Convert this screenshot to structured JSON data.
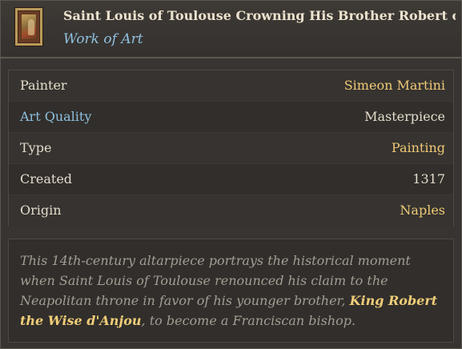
{
  "header": {
    "title": "Saint Louis of Toulouse Crowning His Brother Robert of ...",
    "subtitle": "Work of Art",
    "thumbnail_icon": "painting-thumbnail-icon"
  },
  "properties": [
    {
      "label": "Painter",
      "value": "Simeon Martini",
      "label_color": "#e4dccb",
      "value_color": "#efca76"
    },
    {
      "label": "Art Quality",
      "value": "Masterpiece",
      "label_color": "#8fc0df",
      "value_color": "#e4dccb"
    },
    {
      "label": "Type",
      "value": "Painting",
      "label_color": "#e4dccb",
      "value_color": "#efca76"
    },
    {
      "label": "Created",
      "value": "1317",
      "label_color": "#e4dccb",
      "value_color": "#e4dccb"
    },
    {
      "label": "Origin",
      "value": "Naples",
      "label_color": "#e4dccb",
      "value_color": "#efca76"
    }
  ],
  "description": {
    "line1": "This 14th-century altarpiece portrays the historical moment",
    "line2": "when Saint Louis of Toulouse renounced his claim to the",
    "line3_text": "Neapolitan throne in favor of his younger brother, ",
    "line3_link": "King Robert",
    "line4_link": "the Wise d'Anjou",
    "line4_text": ", to become a Franciscan bishop."
  },
  "colors": {
    "background": "#373431",
    "gold_text": "#efca76",
    "blue_text": "#8fc0df",
    "body_text": "#e4dccb",
    "muted_text": "#a39d93"
  }
}
